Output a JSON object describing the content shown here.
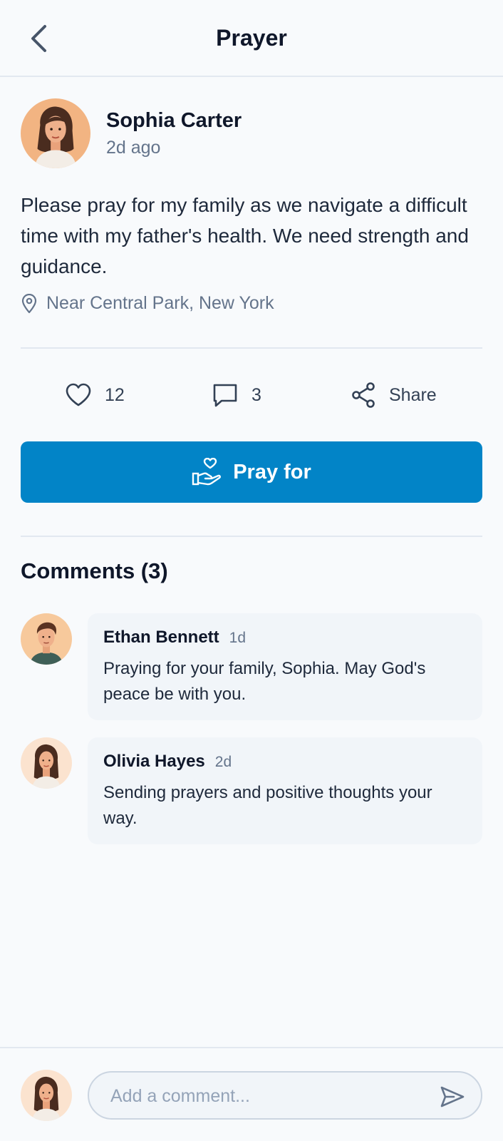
{
  "header": {
    "title": "Prayer"
  },
  "post": {
    "author_name": "Sophia Carter",
    "time": "2d ago",
    "body": "Please pray for my family as we navigate a difficult time with my father's health. We need strength and guidance.",
    "location": "Near Central Park, New York"
  },
  "actions": {
    "likes": "12",
    "comments": "3",
    "share_label": "Share"
  },
  "pray_button": {
    "label": "Pray for"
  },
  "comments": {
    "title": "Comments (3)",
    "items": [
      {
        "name": "Ethan Bennett",
        "time": "1d",
        "text": "Praying for your family, Sophia. May God's peace be with you."
      },
      {
        "name": "Olivia Hayes",
        "time": "2d",
        "text": "Sending prayers and positive thoughts your way."
      }
    ]
  },
  "composer": {
    "placeholder": "Add a comment..."
  },
  "colors": {
    "accent": "#0284c7",
    "background": "#f8fafc",
    "card": "#f1f5f9"
  }
}
